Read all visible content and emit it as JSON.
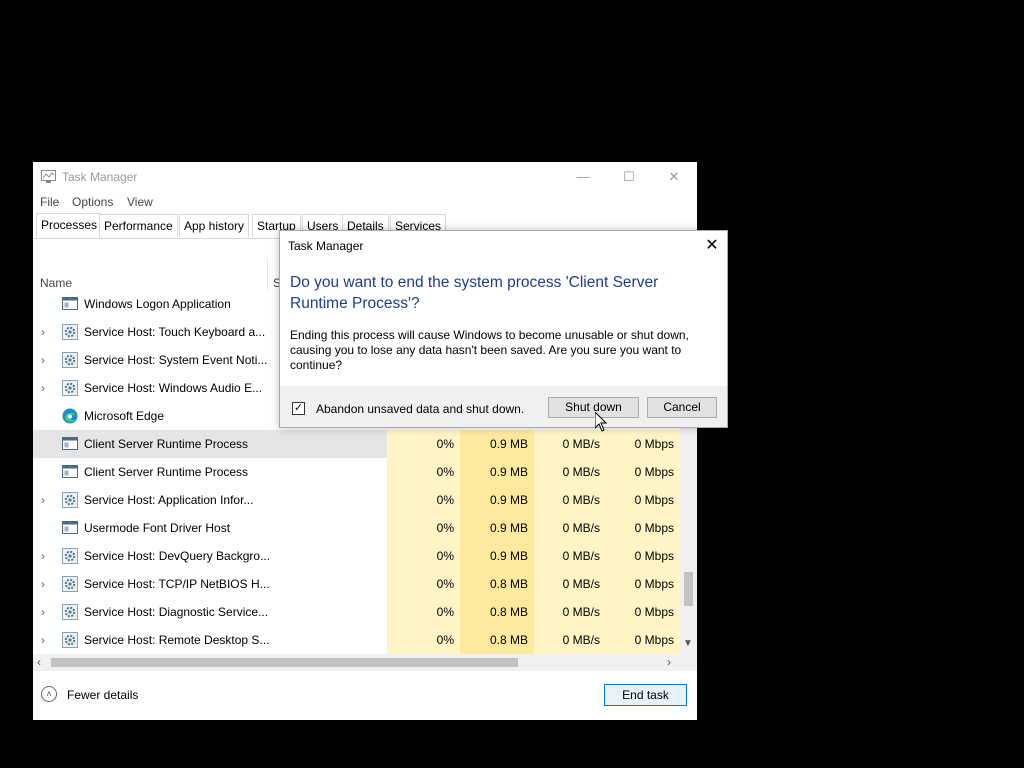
{
  "window": {
    "title": "Task Manager",
    "controls": [
      "—",
      "☐",
      "✕"
    ]
  },
  "menu": [
    "File",
    "Options",
    "View"
  ],
  "tabs": [
    "Processes",
    "Performance",
    "App history",
    "Startup",
    "Users",
    "Details",
    "Services"
  ],
  "columns": {
    "name": "Name",
    "status_partial": "S"
  },
  "rows": [
    {
      "name": "Windows Logon Application",
      "expandable": false,
      "icon": "app-window-icon",
      "cpu": "",
      "memory": "",
      "disk": "",
      "network": ""
    },
    {
      "name": "Service Host: Touch Keyboard a...",
      "expandable": true,
      "icon": "gear-icon",
      "cpu": "",
      "memory": "",
      "disk": "",
      "network": ""
    },
    {
      "name": "Service Host: System Event Noti...",
      "expandable": true,
      "icon": "gear-icon",
      "cpu": "",
      "memory": "",
      "disk": "",
      "network": ""
    },
    {
      "name": "Service Host: Windows Audio E...",
      "expandable": true,
      "icon": "gear-icon",
      "cpu": "",
      "memory": "",
      "disk": "",
      "network": ""
    },
    {
      "name": "Microsoft Edge",
      "expandable": false,
      "icon": "edge-icon",
      "cpu": "",
      "memory": "",
      "disk": "",
      "network": ""
    },
    {
      "name": "Client Server Runtime Process",
      "expandable": false,
      "icon": "app-window-icon",
      "cpu": "0%",
      "memory": "0.9 MB",
      "disk": "0 MB/s",
      "network": "0 Mbps",
      "selected": true
    },
    {
      "name": "Client Server Runtime Process",
      "expandable": false,
      "icon": "app-window-icon",
      "cpu": "0%",
      "memory": "0.9 MB",
      "disk": "0 MB/s",
      "network": "0 Mbps"
    },
    {
      "name": "Service Host: Application Infor...",
      "expandable": true,
      "icon": "gear-icon",
      "cpu": "0%",
      "memory": "0.9 MB",
      "disk": "0 MB/s",
      "network": "0 Mbps"
    },
    {
      "name": "Usermode Font Driver Host",
      "expandable": false,
      "icon": "app-window-icon",
      "cpu": "0%",
      "memory": "0.9 MB",
      "disk": "0 MB/s",
      "network": "0 Mbps"
    },
    {
      "name": "Service Host: DevQuery Backgro...",
      "expandable": true,
      "icon": "gear-icon",
      "cpu": "0%",
      "memory": "0.9 MB",
      "disk": "0 MB/s",
      "network": "0 Mbps"
    },
    {
      "name": "Service Host: TCP/IP NetBIOS H...",
      "expandable": true,
      "icon": "gear-icon",
      "cpu": "0%",
      "memory": "0.8 MB",
      "disk": "0 MB/s",
      "network": "0 Mbps"
    },
    {
      "name": "Service Host: Diagnostic Service...",
      "expandable": true,
      "icon": "gear-icon",
      "cpu": "0%",
      "memory": "0.8 MB",
      "disk": "0 MB/s",
      "network": "0 Mbps"
    },
    {
      "name": "Service Host: Remote Desktop S...",
      "expandable": true,
      "icon": "gear-icon",
      "cpu": "0%",
      "memory": "0.8 MB",
      "disk": "0 MB/s",
      "network": "0 Mbps"
    }
  ],
  "footer": {
    "fewer_details": "Fewer details",
    "end_task": "End task"
  },
  "dialog": {
    "title": "Task Manager",
    "heading": "Do you want to end the system process 'Client Server Runtime Process'?",
    "body": "Ending this process will cause Windows to become unusable or shut down, causing you to lose any data hasn't been saved. Are you sure you want to continue?",
    "checkbox_label": "Abandon unsaved data and shut down.",
    "checkbox_checked": true,
    "shutdown_button": "Shut down",
    "cancel_button": "Cancel"
  },
  "colors": {
    "heading_blue": "#1e3e88",
    "cpu_cell": "#fff4c4",
    "memory_cell": "#ffe99e",
    "end_task_border": "#0078d7"
  }
}
